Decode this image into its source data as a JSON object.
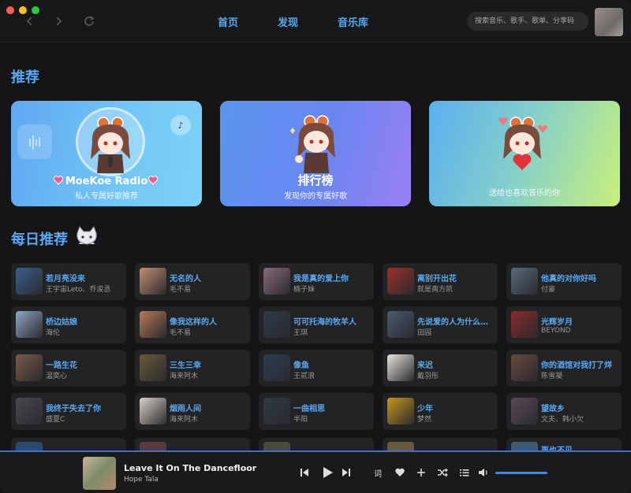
{
  "nav": {
    "links": [
      "首页",
      "发现",
      "音乐库"
    ],
    "search_placeholder": "搜索音乐、歌手、歌单、分享码"
  },
  "recommend": {
    "title": "推荐",
    "cards": [
      {
        "title": "MoeKoe Radio",
        "subtitle": "私人专属好歌推荐"
      },
      {
        "title": "排行榜",
        "subtitle": "发现你的专属好歌"
      },
      {
        "title": "",
        "subtitle": "送给也喜欢音乐的你"
      }
    ]
  },
  "daily": {
    "title": "每日推荐",
    "songs": [
      {
        "title": "若月亮没来",
        "artist": "王宇宙Leto、乔浚丞",
        "color": "#3b5f8c"
      },
      {
        "title": "无名的人",
        "artist": "毛不易",
        "color": "#c48e74"
      },
      {
        "title": "我是真的爱上你",
        "artist": "楠子妹",
        "color": "#8a6a7a"
      },
      {
        "title": "离别开出花",
        "artist": "就是南方凯",
        "color": "#a0302a"
      },
      {
        "title": "他真的对你好吗",
        "artist": "付豪",
        "color": "#5a6b7c"
      },
      {
        "title": "桥边姑娘",
        "artist": "海伦",
        "color": "#8fa7c9"
      },
      {
        "title": "像我这样的人",
        "artist": "毛不易",
        "color": "#b57a56"
      },
      {
        "title": "可可托海的牧羊人",
        "artist": "王琪",
        "color": "#2d3a4a"
      },
      {
        "title": "先说爱的人为什么先离开",
        "artist": "田园",
        "color": "#4a5a6e"
      },
      {
        "title": "光辉岁月",
        "artist": "BEYOND",
        "color": "#8a2a2a"
      },
      {
        "title": "一路生花",
        "artist": "温奕心",
        "color": "#7a5a48"
      },
      {
        "title": "三生三幸",
        "artist": "海来阿木",
        "color": "#6b5a3a"
      },
      {
        "title": "像鱼",
        "artist": "王贰浪",
        "color": "#2a3e56"
      },
      {
        "title": "来迟",
        "artist": "戴羽彤",
        "color": "#e8e4dc"
      },
      {
        "title": "你的酒馆对我打了烊",
        "artist": "陈雪凝",
        "color": "#6a4a3e"
      },
      {
        "title": "我终于失去了你",
        "artist": "盛夏C",
        "color": "#4a4a4e"
      },
      {
        "title": "烟雨人间",
        "artist": "海来阿木",
        "color": "#d9d2c8"
      },
      {
        "title": "一曲相思",
        "artist": "半阳",
        "color": "#2e3a44"
      },
      {
        "title": "少年",
        "artist": "梦然",
        "color": "#c8961e"
      },
      {
        "title": "望故乡",
        "artist": "文夫、韩小欠",
        "color": "#5a4a56"
      }
    ],
    "peek": [
      "",
      "",
      "",
      "",
      "再也不见"
    ]
  },
  "player": {
    "title": "Leave It On The Dancefloor",
    "artist": "Hope Tala",
    "lyric_label": "词",
    "volume": 1.0
  }
}
